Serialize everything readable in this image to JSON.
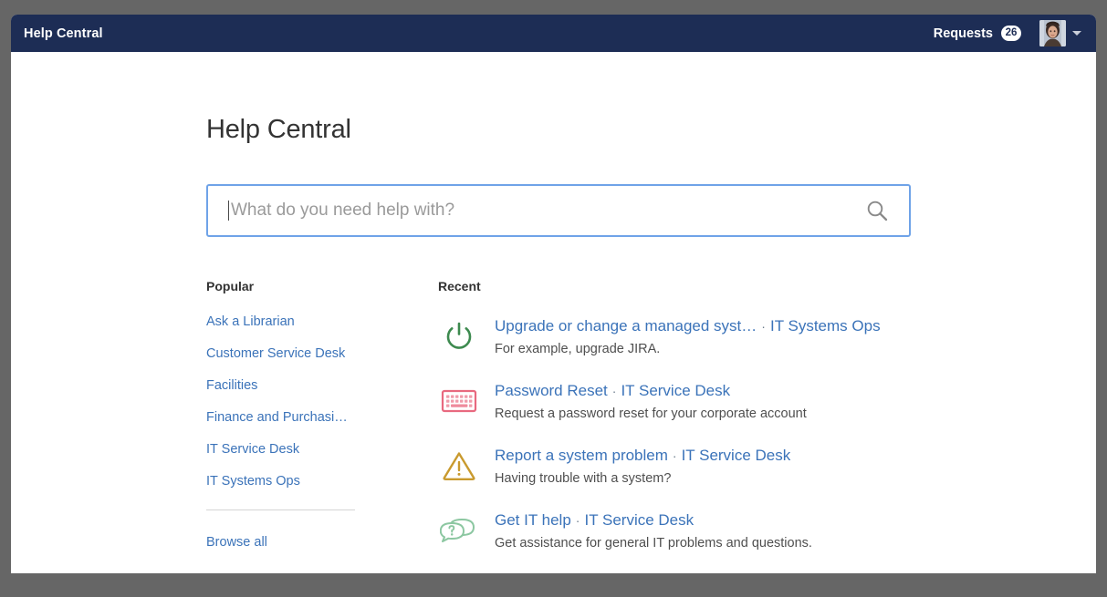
{
  "header": {
    "title": "Help Central",
    "requests_label": "Requests",
    "requests_count": "26",
    "avatar_icon": "user-avatar-photo",
    "chevron_icon": "chevron-down-icon",
    "bar_color": "#1d2d55"
  },
  "main": {
    "page_title": "Help Central",
    "search": {
      "placeholder": "What do you need help with?",
      "value": "",
      "icon": "search-icon",
      "focus_border_color": "#6fa3e8"
    },
    "popular": {
      "heading": "Popular",
      "items": [
        {
          "label": "Ask a Librarian"
        },
        {
          "label": "Customer Service Desk"
        },
        {
          "label": "Facilities"
        },
        {
          "label": "Finance and Purchasi…"
        },
        {
          "label": "IT Service Desk"
        },
        {
          "label": "IT Systems Ops"
        }
      ],
      "browse_all_label": "Browse all"
    },
    "recent": {
      "heading": "Recent",
      "items": [
        {
          "icon": "power-icon",
          "icon_color": "#3d8a4f",
          "title": "Upgrade or change a managed syst…",
          "separator": "·",
          "portal": "IT Systems Ops",
          "description": "For example, upgrade JIRA."
        },
        {
          "icon": "keyboard-icon",
          "icon_color": "#e8697f",
          "title": "Password Reset",
          "separator": "·",
          "portal": "IT Service Desk",
          "description": "Request a password reset for your corporate account"
        },
        {
          "icon": "warning-triangle-icon",
          "icon_color": "#c99a2e",
          "title": "Report a system problem",
          "separator": "·",
          "portal": "IT Service Desk",
          "description": "Having trouble with a system?"
        },
        {
          "icon": "chat-question-icon",
          "icon_color": "#8cc7a1",
          "title": "Get IT help",
          "separator": "·",
          "portal": "IT Service Desk",
          "description": "Get assistance for general IT problems and questions."
        }
      ]
    }
  },
  "colors": {
    "link": "#3b73b9",
    "header_bg": "#1d2d55",
    "page_bg": "#666666"
  }
}
